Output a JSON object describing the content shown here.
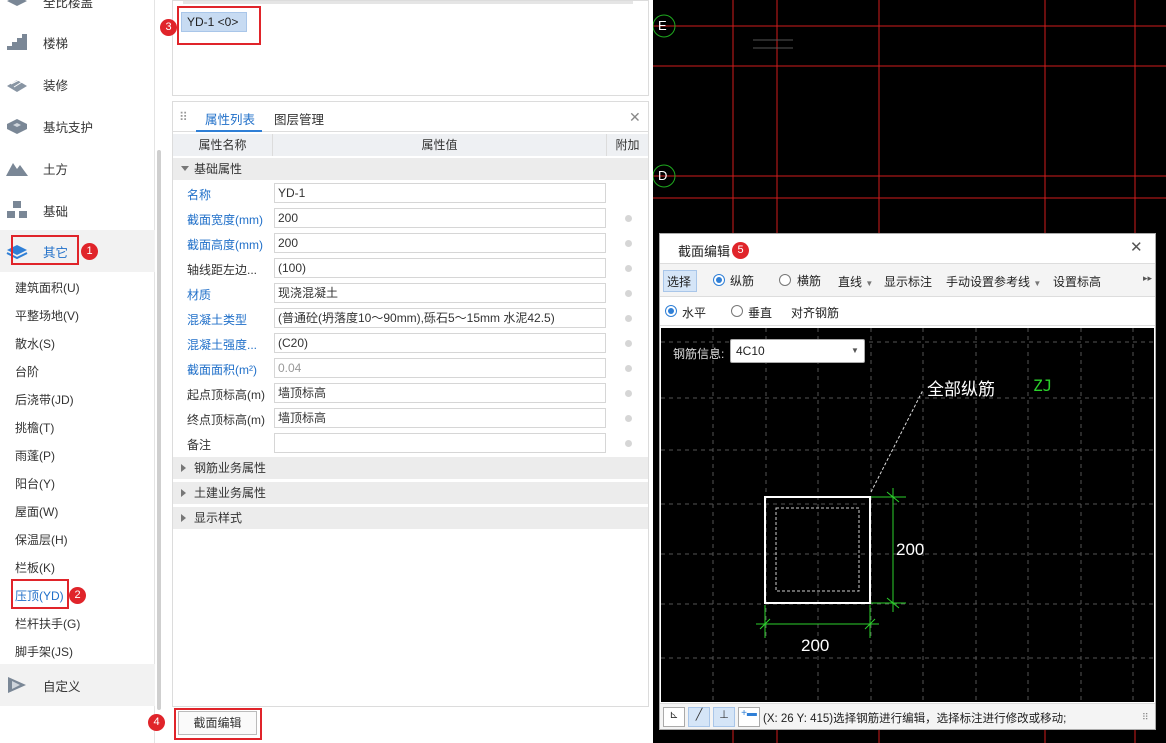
{
  "sidebar": {
    "top_partial": "全比楼盖",
    "categories": [
      {
        "label": "楼梯",
        "icon": "stairs-icon"
      },
      {
        "label": "装修",
        "icon": "decoration-icon"
      },
      {
        "label": "基坑支护",
        "icon": "pit-support-icon"
      },
      {
        "label": "土方",
        "icon": "earthwork-icon"
      },
      {
        "label": "基础",
        "icon": "foundation-icon"
      },
      {
        "label": "其它",
        "icon": "other-icon"
      }
    ],
    "sub_items": [
      "建筑面积(U)",
      "平整场地(V)",
      "散水(S)",
      "台阶",
      "后浇带(JD)",
      "挑檐(T)",
      "雨蓬(P)",
      "阳台(Y)",
      "屋面(W)",
      "保温层(H)",
      "栏板(K)",
      "压顶(YD)",
      "栏杆扶手(G)",
      "脚手架(JS)"
    ],
    "custom": {
      "label": "自定义",
      "icon": "custom-icon"
    }
  },
  "badges": [
    "1",
    "2",
    "3",
    "4",
    "5"
  ],
  "component_list": {
    "item": "YD-1 <0>"
  },
  "property_panel": {
    "tabs": [
      "属性列表",
      "图层管理"
    ],
    "columns": [
      "属性名称",
      "属性值",
      "附加"
    ],
    "group_basic": "基础属性",
    "rows": [
      {
        "name": "名称",
        "value": "YD-1"
      },
      {
        "name": "截面宽度(mm)",
        "value": "200"
      },
      {
        "name": "截面高度(mm)",
        "value": "200"
      },
      {
        "name": "轴线距左边...",
        "value": "(100)"
      },
      {
        "name": "材质",
        "value": "现浇混凝土"
      },
      {
        "name": "混凝土类型",
        "value": "(普通砼(坍落度10～90mm),砾石5～15mm 水泥42.5)"
      },
      {
        "name": "混凝土强度...",
        "value": "(C20)"
      },
      {
        "name": "截面面积(m²)",
        "value": "0.04"
      },
      {
        "name": "起点顶标高(m)",
        "value": "墙顶标高"
      },
      {
        "name": "终点顶标高(m)",
        "value": "墙顶标高"
      },
      {
        "name": "备注",
        "value": ""
      }
    ],
    "groups_collapsed": [
      "钢筋业务属性",
      "土建业务属性",
      "显示样式"
    ]
  },
  "section_edit_button": "截面编辑",
  "cad": {
    "axis_e": "E",
    "axis_d": "D"
  },
  "dialog": {
    "title": "截面编辑",
    "toolbar1": {
      "select": "选择",
      "longitudinal": "纵筋",
      "transverse": "横筋",
      "line": "直线",
      "show_dim": "显示标注",
      "manual_ref": "手动设置参考线",
      "set_elev": "设置标高"
    },
    "toolbar2": {
      "horizontal": "水平",
      "vertical": "垂直",
      "align": "对齐钢筋"
    },
    "rebar_info_label": "钢筋信息:",
    "rebar_info_value": "4C10",
    "annotation": "全部纵筋",
    "annotation_code": "ZJ",
    "dim_width": "200",
    "dim_height": "200",
    "status": "(X: 26 Y: 415)选择钢筋进行编辑，选择标注进行修改或移动;"
  }
}
